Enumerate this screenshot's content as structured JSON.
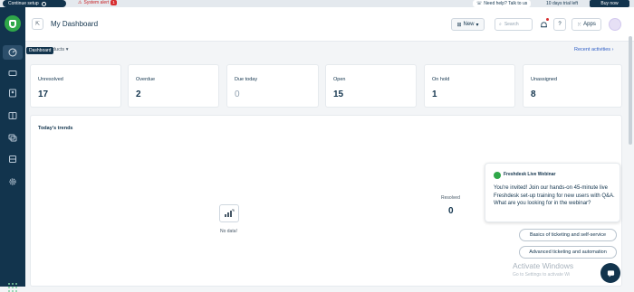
{
  "topbar": {
    "setup_label": "Continue setup",
    "alert_label": "System alert",
    "alert_count": "1",
    "help_label": "Need help? Talk to us",
    "trial_label": "10 days trial left",
    "buy_label": "Buy now"
  },
  "sidebar": {
    "tooltip": "Dashboard",
    "items": [
      "dashboard-icon",
      "tickets-icon",
      "contacts-icon",
      "solutions-icon",
      "forums-icon",
      "reports-icon",
      "admin-icon"
    ]
  },
  "header": {
    "title": "My Dashboard",
    "new_label": "New",
    "search_placeholder": "Search",
    "apps_label": "Apps",
    "help_symbol": "?"
  },
  "subbar": {
    "products_label": "ducts",
    "recent_label": "Recent activities"
  },
  "cards": [
    {
      "label": "Unresolved",
      "value": "17"
    },
    {
      "label": "Overdue",
      "value": "2"
    },
    {
      "label": "Due today",
      "value": "0"
    },
    {
      "label": "Open",
      "value": "15"
    },
    {
      "label": "On hold",
      "value": "1"
    },
    {
      "label": "Unassigned",
      "value": "8"
    }
  ],
  "trends": {
    "title": "Today's trends",
    "no_data": "No data!",
    "resolved_label": "Resolved",
    "resolved_value": "0"
  },
  "webinar": {
    "title": "Freshdesk Live Webinar",
    "body": "You're invited! Join our hands-on 45-minute live Freshdesk set-up training for new users with Q&A. What are you looking for in the webinar?",
    "option1": "Basics of ticketing and self-service",
    "option2": "Advanced ticketing and automation"
  },
  "watermark": {
    "line1": "Activate Windows",
    "line2": "Go to Settings to activate Wi"
  },
  "colors": {
    "sidebar": "#12344d",
    "brand_green": "#2fa749",
    "link_blue": "#2c5cc5",
    "alert_red": "#d72d30"
  }
}
